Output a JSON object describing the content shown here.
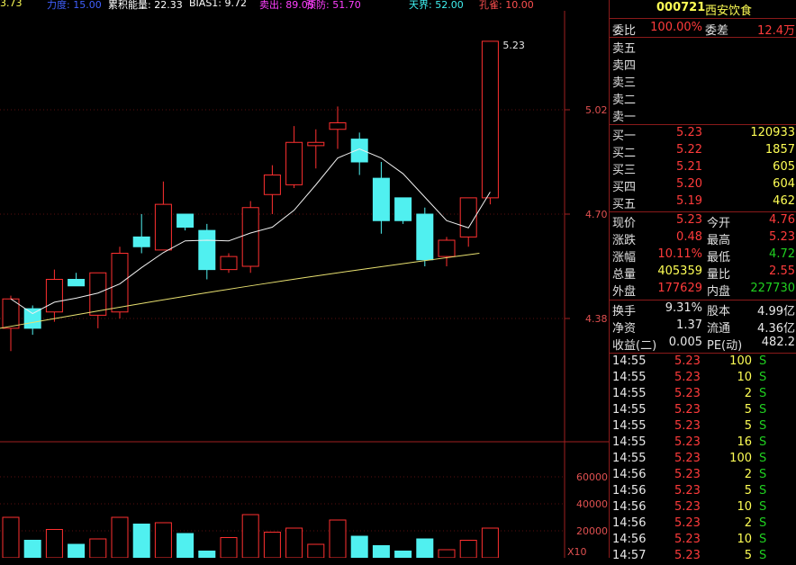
{
  "header": {
    "items": [
      {
        "text": "3.73",
        "color": "#ffff55"
      },
      {
        "text": "力度: 15.00",
        "color": "#4060ff"
      },
      {
        "text": "累积能量: 22.33",
        "color": "#ffffff"
      },
      {
        "text": "BIAS1: 9.72",
        "color": "#ffffff"
      },
      {
        "text": "卖出: 89.05",
        "color": "#ff40ff"
      },
      {
        "text": "预防: 51.70",
        "color": "#ff40ff"
      },
      {
        "text": "天界: 52.00",
        "color": "#40f0f0"
      },
      {
        "text": "孔雀: 10.00",
        "color": "#ff5050"
      }
    ]
  },
  "chart_data": [
    {
      "type": "candlestick",
      "yticks": [
        "5.02",
        "4.70",
        "4.38"
      ],
      "last_price_label": "5.23",
      "candles": [
        {
          "o": 4.35,
          "h": 4.45,
          "l": 4.28,
          "c": 4.44
        },
        {
          "o": 4.41,
          "h": 4.42,
          "l": 4.33,
          "c": 4.35
        },
        {
          "o": 4.4,
          "h": 4.53,
          "l": 4.37,
          "c": 4.5
        },
        {
          "o": 4.5,
          "h": 4.52,
          "l": 4.48,
          "c": 4.48
        },
        {
          "o": 4.39,
          "h": 4.52,
          "l": 4.35,
          "c": 4.52
        },
        {
          "o": 4.4,
          "h": 4.6,
          "l": 4.38,
          "c": 4.58
        },
        {
          "o": 4.63,
          "h": 4.7,
          "l": 4.58,
          "c": 4.6
        },
        {
          "o": 4.59,
          "h": 4.8,
          "l": 4.59,
          "c": 4.73
        },
        {
          "o": 4.7,
          "h": 4.7,
          "l": 4.65,
          "c": 4.66
        },
        {
          "o": 4.65,
          "h": 4.67,
          "l": 4.5,
          "c": 4.53
        },
        {
          "o": 4.53,
          "h": 4.58,
          "l": 4.52,
          "c": 4.57
        },
        {
          "o": 4.54,
          "h": 4.74,
          "l": 4.52,
          "c": 4.72
        },
        {
          "o": 4.76,
          "h": 4.85,
          "l": 4.7,
          "c": 4.82
        },
        {
          "o": 4.79,
          "h": 4.97,
          "l": 4.78,
          "c": 4.92
        },
        {
          "o": 4.91,
          "h": 4.96,
          "l": 4.84,
          "c": 4.92
        },
        {
          "o": 4.96,
          "h": 5.03,
          "l": 4.9,
          "c": 4.98
        },
        {
          "o": 4.93,
          "h": 4.95,
          "l": 4.82,
          "c": 4.86
        },
        {
          "o": 4.81,
          "h": 4.86,
          "l": 4.64,
          "c": 4.68
        },
        {
          "o": 4.75,
          "h": 4.75,
          "l": 4.67,
          "c": 4.68
        },
        {
          "o": 4.7,
          "h": 4.72,
          "l": 4.54,
          "c": 4.56
        },
        {
          "o": 4.57,
          "h": 4.63,
          "l": 4.54,
          "c": 4.62
        },
        {
          "o": 4.63,
          "h": 4.75,
          "l": 4.6,
          "c": 4.75
        },
        {
          "o": 4.75,
          "h": 5.23,
          "l": 4.73,
          "c": 5.23
        }
      ]
    },
    {
      "type": "bar",
      "yticks": [
        "60000",
        "40000",
        "20000"
      ],
      "unit_label": "X10",
      "values": [
        30000,
        13000,
        21000,
        10000,
        14000,
        30000,
        25000,
        26000,
        18000,
        5000,
        15000,
        32000,
        19000,
        22000,
        10000,
        28000,
        16000,
        9000,
        5000,
        14000,
        6000,
        13000,
        22000
      ]
    }
  ],
  "stock": {
    "code": "000721",
    "name": "西安饮食"
  },
  "weibi": {
    "label": "委比",
    "value": "100.00%",
    "diff_label": "委差",
    "diff_value": "12.4万"
  },
  "asks": [
    {
      "label": "卖五"
    },
    {
      "label": "卖四"
    },
    {
      "label": "卖三"
    },
    {
      "label": "卖二"
    },
    {
      "label": "卖一"
    }
  ],
  "bids": [
    {
      "label": "买一",
      "price": "5.23",
      "vol": "120933"
    },
    {
      "label": "买二",
      "price": "5.22",
      "vol": "1857"
    },
    {
      "label": "买三",
      "price": "5.21",
      "vol": "605"
    },
    {
      "label": "买四",
      "price": "5.20",
      "vol": "604"
    },
    {
      "label": "买五",
      "price": "5.19",
      "vol": "462"
    }
  ],
  "quote": [
    {
      "l1": "现价",
      "v1": "5.23",
      "l2": "今开",
      "v2": "4.76"
    },
    {
      "l1": "涨跌",
      "v1": "0.48",
      "l2": "最高",
      "v2": "5.23"
    },
    {
      "l1": "涨幅",
      "v1": "10.11%",
      "l2": "最低",
      "v2": "4.72"
    },
    {
      "l1": "总量",
      "v1": "405359",
      "l2": "量比",
      "v2": "2.55"
    },
    {
      "l1": "外盘",
      "v1": "177629",
      "l2": "内盘",
      "v2": "227730"
    }
  ],
  "fin": [
    {
      "l1": "换手",
      "v1": "9.31%",
      "l2": "股本",
      "v2": "4.99亿"
    },
    {
      "l1": "净资",
      "v1": "1.37",
      "l2": "流通",
      "v2": "4.36亿"
    },
    {
      "l1": "收益(二)",
      "v1": "0.005",
      "l2": "PE(动)",
      "v2": "482.2"
    }
  ],
  "ticks": [
    {
      "t": "14:55",
      "p": "5.23",
      "v": "100",
      "s": "S"
    },
    {
      "t": "14:55",
      "p": "5.23",
      "v": "10",
      "s": "S"
    },
    {
      "t": "14:55",
      "p": "5.23",
      "v": "2",
      "s": "S"
    },
    {
      "t": "14:55",
      "p": "5.23",
      "v": "5",
      "s": "S"
    },
    {
      "t": "14:55",
      "p": "5.23",
      "v": "5",
      "s": "S"
    },
    {
      "t": "14:55",
      "p": "5.23",
      "v": "16",
      "s": "S"
    },
    {
      "t": "14:55",
      "p": "5.23",
      "v": "100",
      "s": "S"
    },
    {
      "t": "14:56",
      "p": "5.23",
      "v": "2",
      "s": "S"
    },
    {
      "t": "14:56",
      "p": "5.23",
      "v": "5",
      "s": "S"
    },
    {
      "t": "14:56",
      "p": "5.23",
      "v": "10",
      "s": "S"
    },
    {
      "t": "14:56",
      "p": "5.23",
      "v": "2",
      "s": "S"
    },
    {
      "t": "14:56",
      "p": "5.23",
      "v": "10",
      "s": "S"
    },
    {
      "t": "14:57",
      "p": "5.23",
      "v": "5",
      "s": "S"
    }
  ]
}
